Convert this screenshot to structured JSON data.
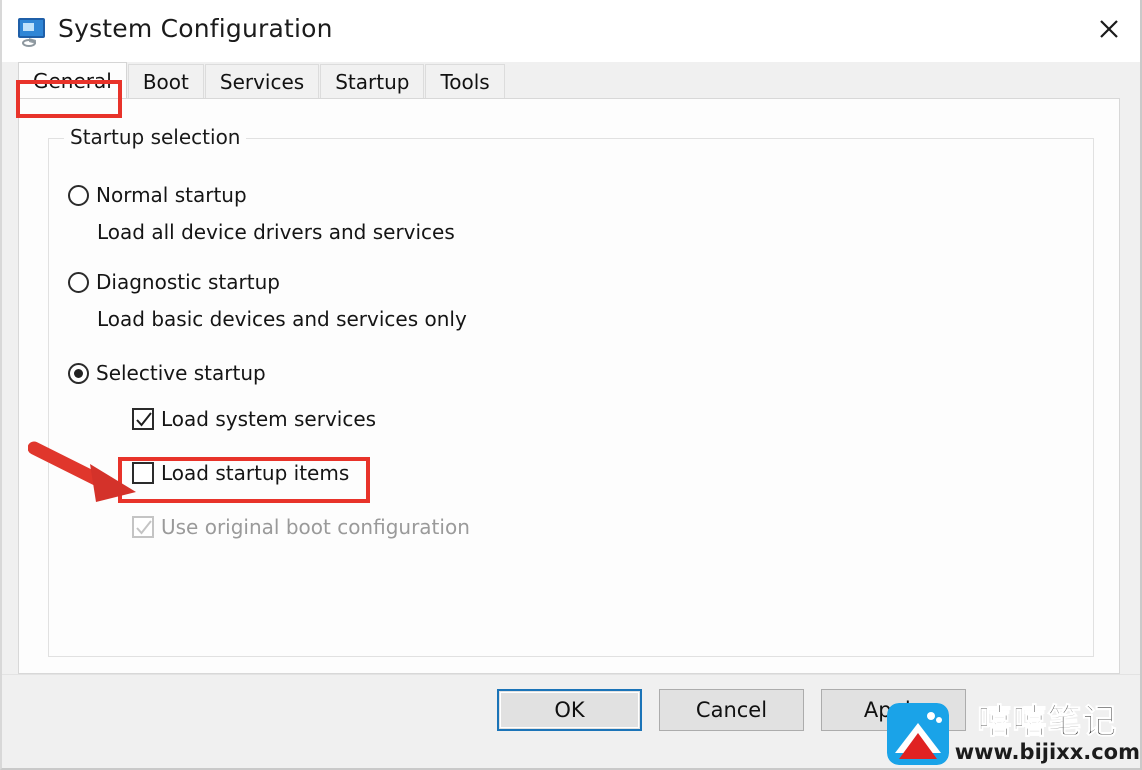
{
  "window": {
    "title": "System Configuration",
    "app_icon": "system-configuration-icon",
    "close_label": "✕"
  },
  "tabs": [
    {
      "label": "General",
      "selected": true,
      "highlighted": true
    },
    {
      "label": "Boot",
      "selected": false,
      "highlighted": false
    },
    {
      "label": "Services",
      "selected": false,
      "highlighted": false
    },
    {
      "label": "Startup",
      "selected": false,
      "highlighted": false
    },
    {
      "label": "Tools",
      "selected": false,
      "highlighted": false
    }
  ],
  "general_tab": {
    "groupbox_legend": "Startup selection",
    "options": [
      {
        "id": "normal-startup",
        "label": "Normal startup",
        "checked": false,
        "description": "Load all device drivers and services"
      },
      {
        "id": "diagnostic-startup",
        "label": "Diagnostic startup",
        "checked": false,
        "description": "Load basic devices and services only"
      },
      {
        "id": "selective-startup",
        "label": "Selective startup",
        "checked": true,
        "description": ""
      }
    ],
    "checkboxes": [
      {
        "id": "load-system-services",
        "label": "Load system services",
        "checked": true,
        "disabled": false,
        "highlighted": false
      },
      {
        "id": "load-startup-items",
        "label": "Load startup items",
        "checked": false,
        "disabled": false,
        "highlighted": true
      },
      {
        "id": "use-original-boot-configuration",
        "label": "Use original boot configuration",
        "checked": true,
        "disabled": true,
        "highlighted": false
      }
    ]
  },
  "buttons": {
    "ok": "OK",
    "cancel": "Cancel",
    "apply": "Apply"
  },
  "watermark": {
    "name": "嘻嘻笔记",
    "url": "www.bijixx.com"
  },
  "colors": {
    "annotation_red": "#e8332a",
    "default_button_focus": "#1b74b8",
    "window_chrome": "#f0f0f0",
    "panel_background": "#fdfdfd",
    "logo_blue": "#1aa3e8",
    "logo_red": "#e02222"
  }
}
